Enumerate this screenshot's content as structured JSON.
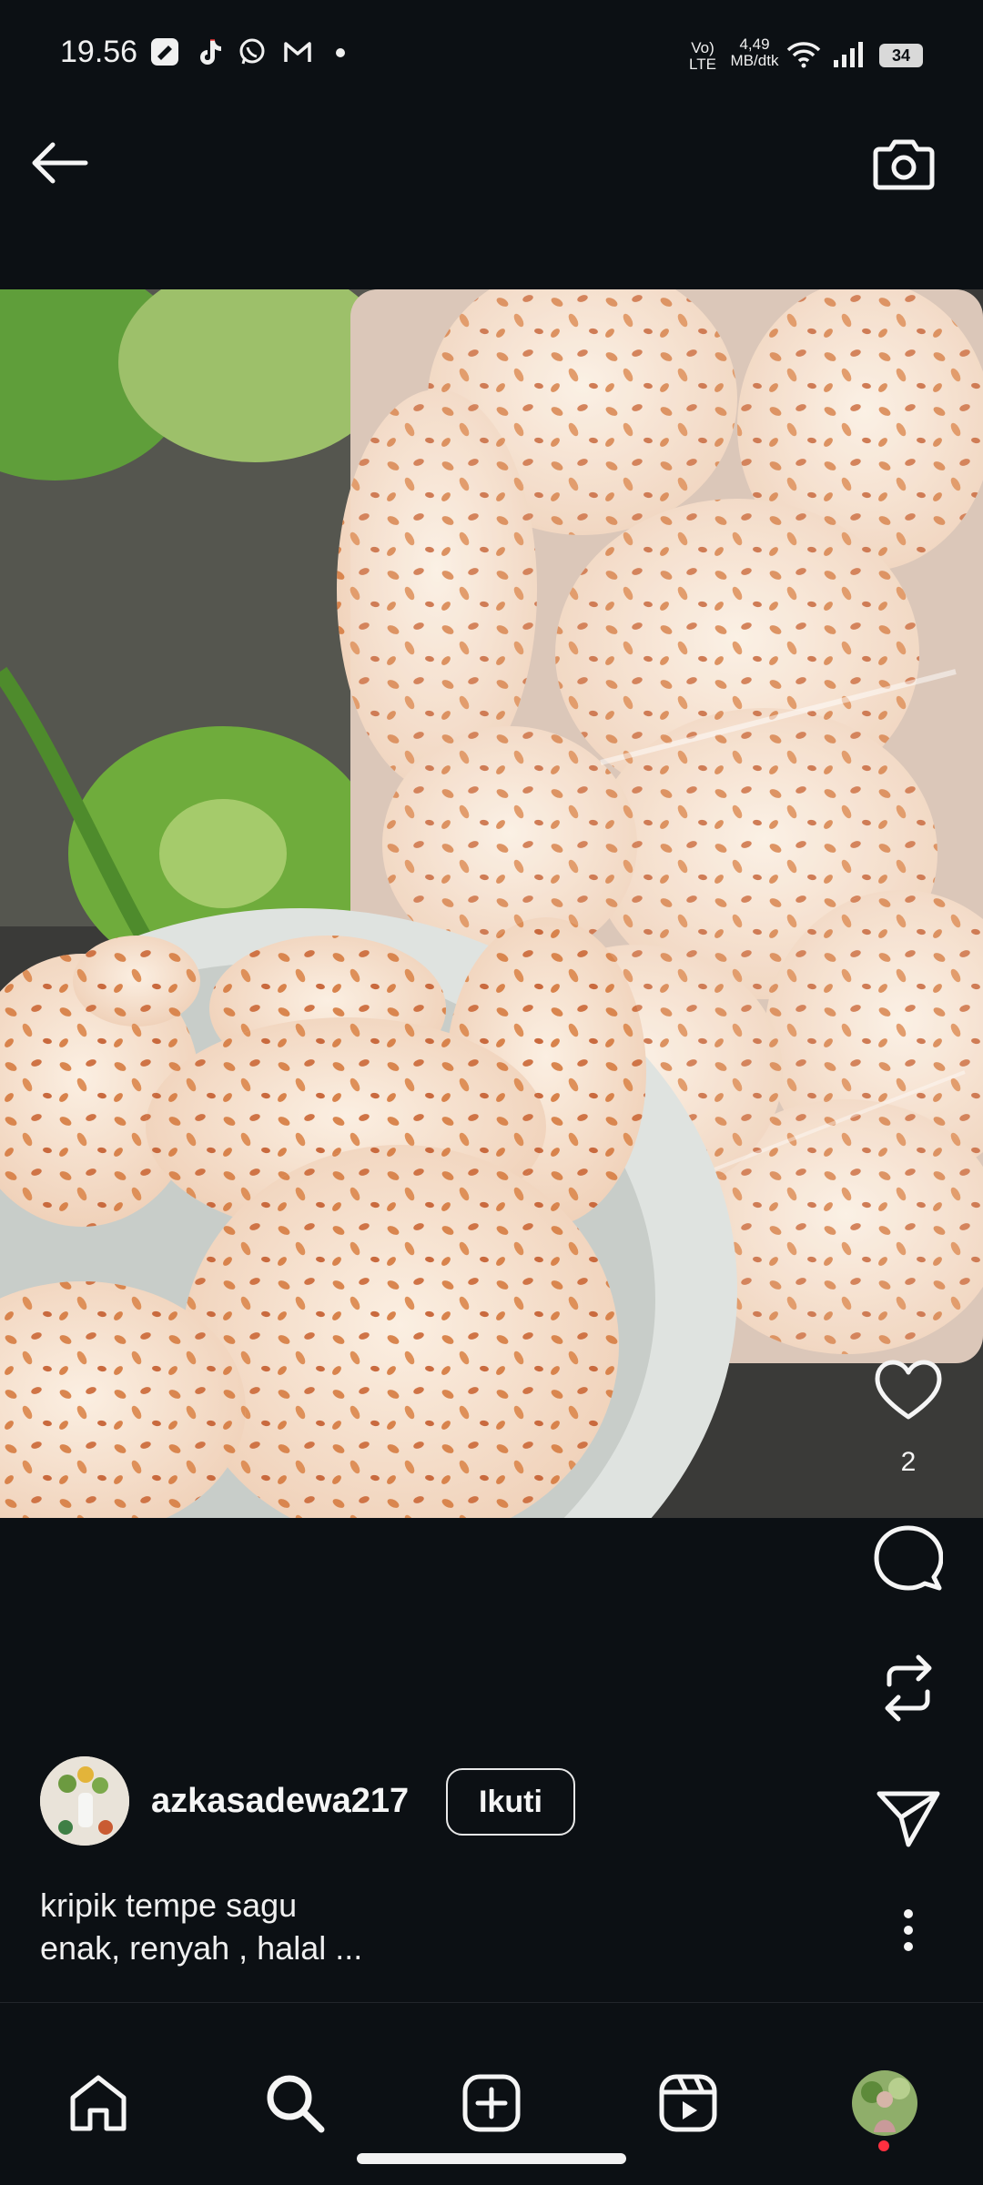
{
  "status_bar": {
    "time": "19.56",
    "network_type_top": "Vo)",
    "network_type_bottom": "LTE",
    "speed_value": "4,49",
    "speed_unit": "MB/dtk",
    "battery": "34",
    "notification_icons": [
      "screen-recorder-icon",
      "tiktok-icon",
      "whatsapp-icon",
      "gmail-icon",
      "dot-icon"
    ]
  },
  "post": {
    "likes": "2",
    "username": "azkasadewa217",
    "follow_label": "Ikuti",
    "caption_line1": "kripik tempe sagu",
    "caption_line2": "enak, renyah , halal ..."
  },
  "colors": {
    "background": "#0c1014",
    "text": "#f5f5f5",
    "notification_dot": "#ff3040"
  }
}
